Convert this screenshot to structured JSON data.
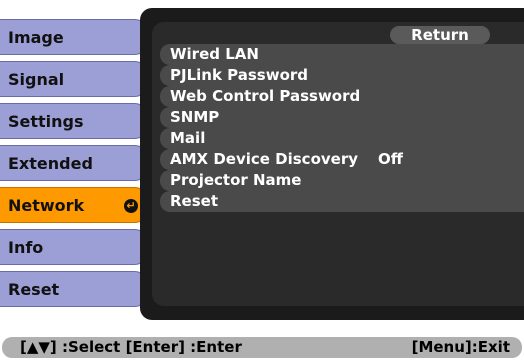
{
  "tabs": [
    {
      "label": "Image"
    },
    {
      "label": "Signal"
    },
    {
      "label": "Settings"
    },
    {
      "label": "Extended"
    },
    {
      "label": "Network"
    },
    {
      "label": "Info"
    },
    {
      "label": "Reset"
    }
  ],
  "active_tab": "Network",
  "return_label": "Return",
  "menu": {
    "items": [
      {
        "label": "Wired LAN",
        "value": ""
      },
      {
        "label": "PJLink Password",
        "value": ""
      },
      {
        "label": "Web Control Password",
        "value": ""
      },
      {
        "label": "SNMP",
        "value": ""
      },
      {
        "label": "Mail",
        "value": ""
      },
      {
        "label": "AMX Device Discovery",
        "value": "Off"
      },
      {
        "label": "Projector Name",
        "value": ""
      },
      {
        "label": "Reset",
        "value": ""
      }
    ]
  },
  "footer": {
    "left": "[▲▼] :Select  [Enter] :Enter",
    "right": "[Menu]:Exit"
  },
  "colors": {
    "tab": "#9c9ed6",
    "active_tab": "#ff9900",
    "panel": "#1b1b1b",
    "menu_item": "#4a4a4a",
    "footer": "#b0b0b0"
  },
  "icons": {
    "enter": "enter-icon"
  }
}
